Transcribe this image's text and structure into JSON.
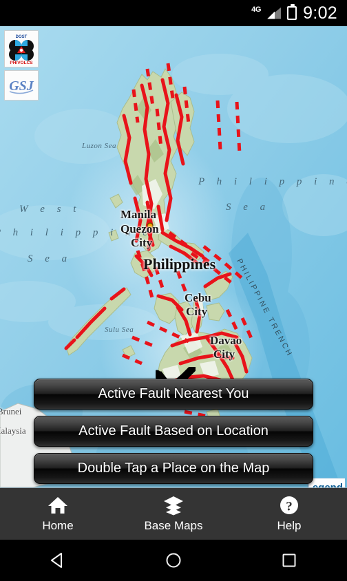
{
  "status_bar": {
    "network": "4G",
    "time": "9:02",
    "battery_icon": "battery-charging-icon",
    "signal_icon": "signal-bars-icon"
  },
  "map": {
    "logos": [
      {
        "name": "DOST PHIVOLCS",
        "top_text": "DOST",
        "bottom_text": "PHIVOLCS"
      },
      {
        "name": "GSJ",
        "text": "GSJ"
      }
    ],
    "sea_labels": [
      {
        "id": "luzon_sea",
        "text": "Luzon Sea"
      },
      {
        "id": "west_philippine_sea_1",
        "text": "W e s t"
      },
      {
        "id": "west_philippine_sea_2",
        "text": "P h i l i p p i n e"
      },
      {
        "id": "west_philippine_sea_3",
        "text": "S e a"
      },
      {
        "id": "philippine_sea_1",
        "text": "P h i l i p p i n e"
      },
      {
        "id": "philippine_sea_2",
        "text": "S e a"
      },
      {
        "id": "sulu_sea",
        "text": "Sulu Sea"
      }
    ],
    "country_label": "Philippines",
    "city_labels": [
      {
        "id": "manila",
        "text": "Manila"
      },
      {
        "id": "quezon_city_1",
        "text": "Quezon"
      },
      {
        "id": "quezon_city_2",
        "text": "City"
      },
      {
        "id": "cebu_1",
        "text": "Cebu"
      },
      {
        "id": "cebu_2",
        "text": "City"
      },
      {
        "id": "davao_1",
        "text": "Davao"
      },
      {
        "id": "davao_2",
        "text": "City"
      }
    ],
    "neighbor_labels": [
      {
        "id": "brunei",
        "text": "Brunei"
      },
      {
        "id": "malaysia",
        "text": "Malaysia"
      }
    ],
    "trench_label": "PHILIPPINE TRENCH",
    "legend_button": "Legend",
    "fault_color": "#e8131a",
    "ocean_color": "#9ed3ea",
    "land_color": "#c9d9ae"
  },
  "actions": {
    "nearest": "Active Fault Nearest You",
    "location": "Active Fault Based on Location",
    "double_tap": "Double Tap a Place on the Map"
  },
  "tab_bar": {
    "items": [
      {
        "label": "Home",
        "icon": "home-icon"
      },
      {
        "label": "Base Maps",
        "icon": "layers-icon"
      },
      {
        "label": "Help",
        "icon": "question-circle-icon"
      }
    ]
  },
  "android_nav": {
    "back": "back-triangle-icon",
    "home": "home-circle-icon",
    "recents": "recents-square-icon"
  }
}
